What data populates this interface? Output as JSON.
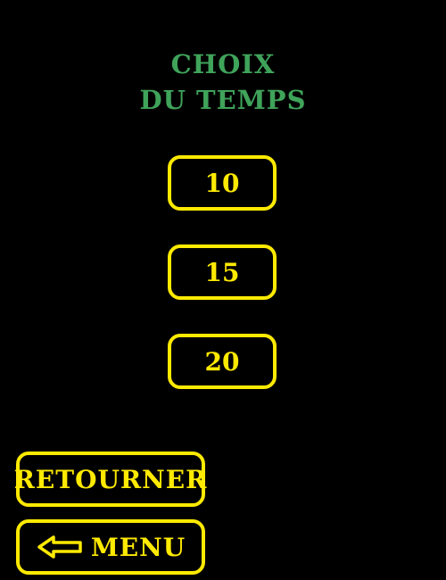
{
  "title": {
    "line1": "CHOIX",
    "line2": "DU TEMPS"
  },
  "time_options": [
    "10",
    "15",
    "20"
  ],
  "navigation": {
    "back_label": "RETOURNER",
    "menu_label": "MENU",
    "menu_icon": "arrow-left-icon"
  },
  "colors": {
    "background": "#000000",
    "title": "#3fa35a",
    "button": "#ffea00"
  }
}
